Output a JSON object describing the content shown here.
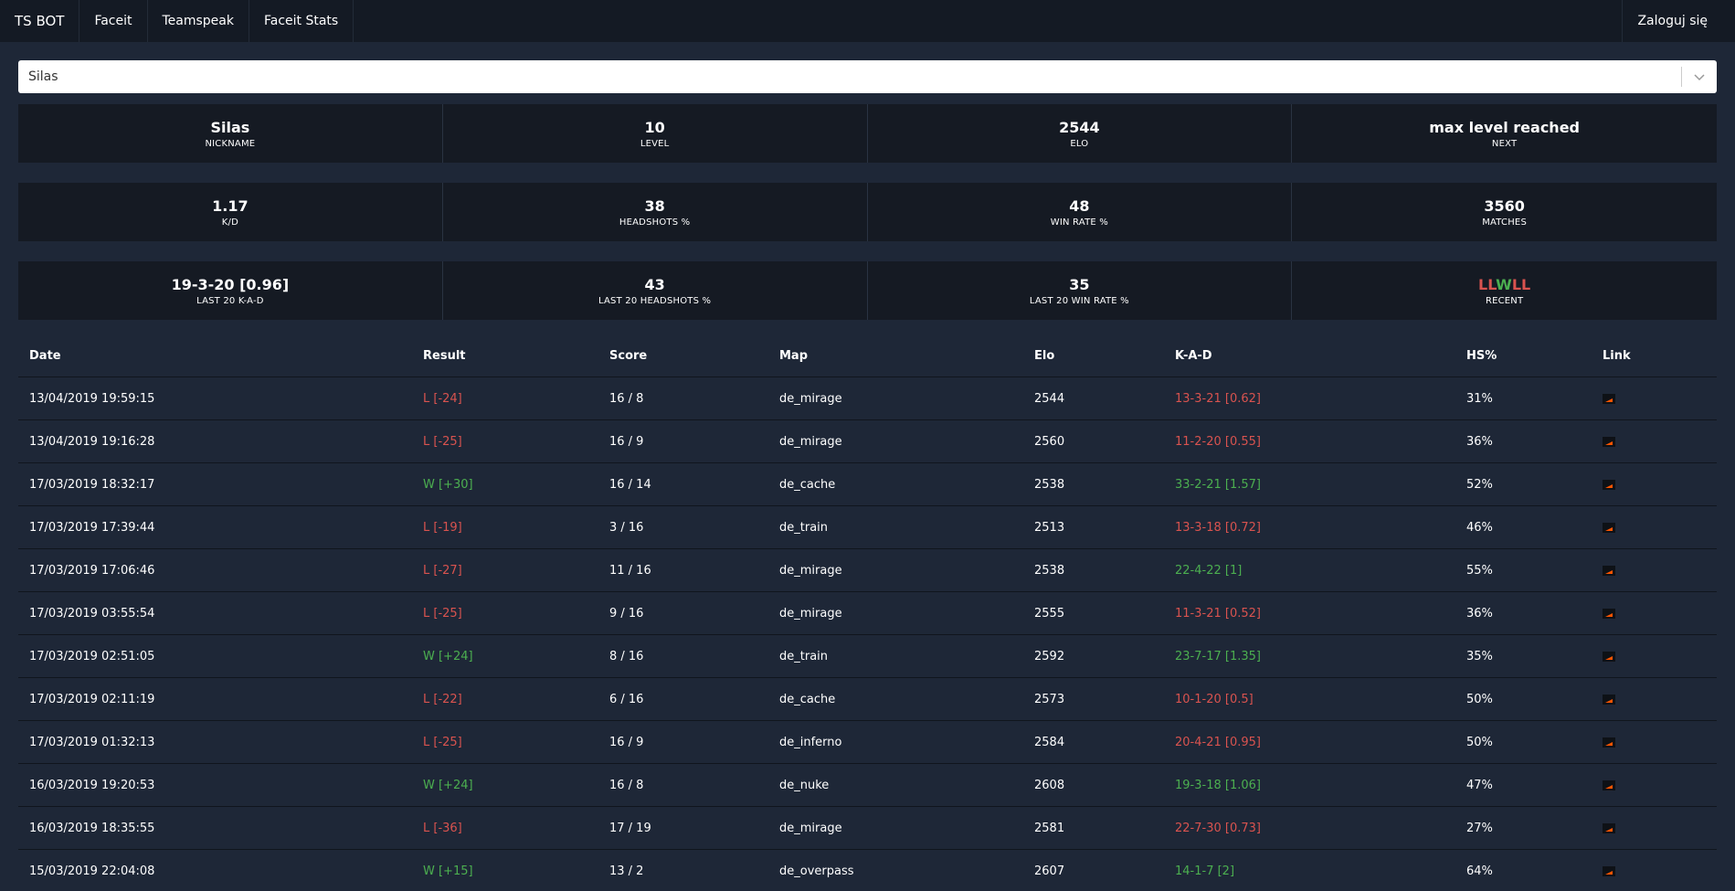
{
  "navbar": {
    "brand": "TS BOT",
    "items": [
      "Faceit",
      "Teamspeak",
      "Faceit Stats"
    ],
    "login": "Zaloguj się"
  },
  "player_select": {
    "value": "Silas"
  },
  "stats": [
    [
      {
        "value": "Silas",
        "label": "NICKNAME"
      },
      {
        "value": "10",
        "label": "LEVEL"
      },
      {
        "value": "2544",
        "label": "ELO"
      },
      {
        "value": "max level reached",
        "label": "NEXT"
      }
    ],
    [
      {
        "value": "1.17",
        "label": "K/D"
      },
      {
        "value": "38",
        "label": "HEADSHOTS %"
      },
      {
        "value": "48",
        "label": "WIN RATE %"
      },
      {
        "value": "3560",
        "label": "MATCHES"
      }
    ],
    [
      {
        "value": "19-3-20 [0.96]",
        "label": "LAST 20 K-A-D"
      },
      {
        "value": "43",
        "label": "LAST 20 HEADSHOTS %"
      },
      {
        "value": "35",
        "label": "LAST 20 WIN RATE %"
      },
      {
        "value": "LLWLL",
        "label": "RECENT"
      }
    ]
  ],
  "colors": {
    "loss": "#d9534f",
    "win": "#4caf50",
    "background": "#1e2737",
    "card": "#151a23"
  },
  "table": {
    "headers": [
      "Date",
      "Result",
      "Score",
      "Map",
      "Elo",
      "K-A-D",
      "HS%",
      "Link"
    ],
    "rows": [
      {
        "date": "13/04/2019 19:59:15",
        "result": "L [-24]",
        "score": "16 / 8",
        "map": "de_mirage",
        "elo": "2544",
        "kad": "13-3-21 [0.62]",
        "hs": "31%",
        "win": false
      },
      {
        "date": "13/04/2019 19:16:28",
        "result": "L [-25]",
        "score": "16 / 9",
        "map": "de_mirage",
        "elo": "2560",
        "kad": "11-2-20 [0.55]",
        "hs": "36%",
        "win": false
      },
      {
        "date": "17/03/2019 18:32:17",
        "result": "W [+30]",
        "score": "16 / 14",
        "map": "de_cache",
        "elo": "2538",
        "kad": "33-2-21 [1.57]",
        "hs": "52%",
        "win": true
      },
      {
        "date": "17/03/2019 17:39:44",
        "result": "L [-19]",
        "score": "3 / 16",
        "map": "de_train",
        "elo": "2513",
        "kad": "13-3-18 [0.72]",
        "hs": "46%",
        "win": false
      },
      {
        "date": "17/03/2019 17:06:46",
        "result": "L [-27]",
        "score": "11 / 16",
        "map": "de_mirage",
        "elo": "2538",
        "kad": "22-4-22 [1]",
        "hs": "55%",
        "win": false,
        "kad_win": true
      },
      {
        "date": "17/03/2019 03:55:54",
        "result": "L [-25]",
        "score": "9 / 16",
        "map": "de_mirage",
        "elo": "2555",
        "kad": "11-3-21 [0.52]",
        "hs": "36%",
        "win": false
      },
      {
        "date": "17/03/2019 02:51:05",
        "result": "W [+24]",
        "score": "8 / 16",
        "map": "de_train",
        "elo": "2592",
        "kad": "23-7-17 [1.35]",
        "hs": "35%",
        "win": true
      },
      {
        "date": "17/03/2019 02:11:19",
        "result": "L [-22]",
        "score": "6 / 16",
        "map": "de_cache",
        "elo": "2573",
        "kad": "10-1-20 [0.5]",
        "hs": "50%",
        "win": false
      },
      {
        "date": "17/03/2019 01:32:13",
        "result": "L [-25]",
        "score": "16 / 9",
        "map": "de_inferno",
        "elo": "2584",
        "kad": "20-4-21 [0.95]",
        "hs": "50%",
        "win": false
      },
      {
        "date": "16/03/2019 19:20:53",
        "result": "W [+24]",
        "score": "16 / 8",
        "map": "de_nuke",
        "elo": "2608",
        "kad": "19-3-18 [1.06]",
        "hs": "47%",
        "win": true
      },
      {
        "date": "16/03/2019 18:35:55",
        "result": "L [-36]",
        "score": "17 / 19",
        "map": "de_mirage",
        "elo": "2581",
        "kad": "22-7-30 [0.73]",
        "hs": "27%",
        "win": false
      },
      {
        "date": "15/03/2019 22:04:08",
        "result": "W [+15]",
        "score": "13 / 2",
        "map": "de_overpass",
        "elo": "2607",
        "kad": "14-1-7 [2]",
        "hs": "64%",
        "win": true
      }
    ]
  }
}
